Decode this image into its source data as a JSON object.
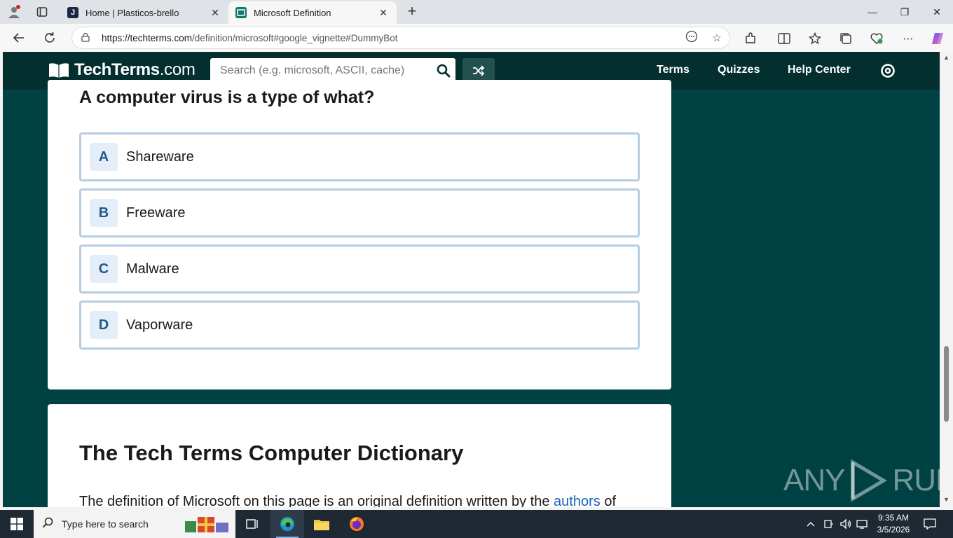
{
  "browser": {
    "tabs": [
      {
        "title": "Home | Plasticos-brello",
        "favicon_letter": "J",
        "active": false
      },
      {
        "title": "Microsoft Definition",
        "favicon_letter": "",
        "active": true
      }
    ],
    "url_domain": "https://techterms.com",
    "url_path": "/definition/microsoft#google_vignette#DummyBot"
  },
  "site": {
    "logo_main": "TechTerms",
    "logo_suffix": ".com",
    "search_placeholder": "Search (e.g. microsoft, ASCII, cache)",
    "nav": [
      "Terms",
      "Quizzes",
      "Help Center"
    ]
  },
  "quiz": {
    "question": "A computer virus is a type of what?",
    "options": [
      {
        "letter": "A",
        "text": "Shareware"
      },
      {
        "letter": "B",
        "text": "Freeware"
      },
      {
        "letter": "C",
        "text": "Malware"
      },
      {
        "letter": "D",
        "text": "Vaporware"
      }
    ]
  },
  "dictionary": {
    "title": "The Tech Terms Computer Dictionary",
    "text_before": "The definition of Microsoft on this page is an original definition written by the ",
    "link": "authors",
    "text_after": " of"
  },
  "watermark": {
    "left": "ANY",
    "right": "RUN"
  },
  "taskbar": {
    "search_placeholder": "Type here to search",
    "time": "9:35 AM",
    "date": "3/5/2026"
  },
  "colors": {
    "page_bg": "#004244",
    "header_bg": "#03302e",
    "option_border": "#b5cde3",
    "letter_color": "#1f5a8c",
    "link_color": "#1a63b8"
  }
}
